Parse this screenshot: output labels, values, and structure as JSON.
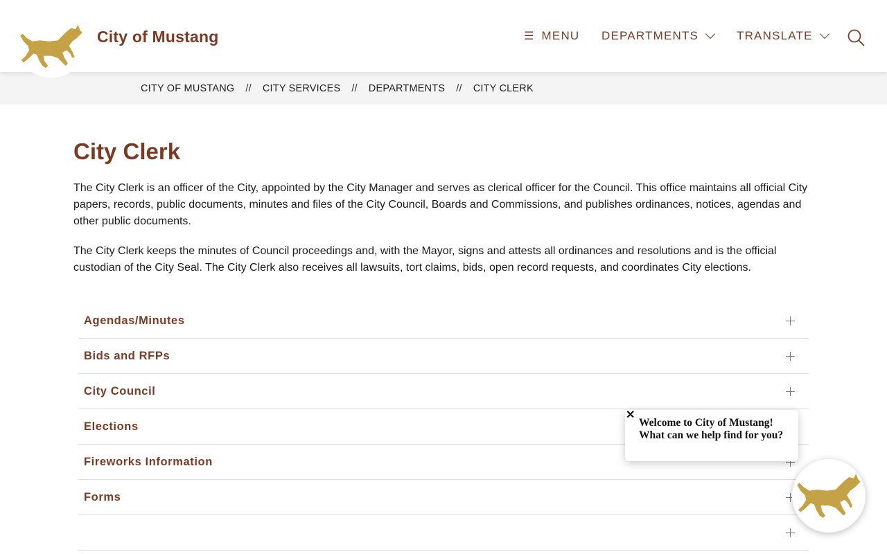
{
  "header": {
    "site_title": "City of Mustang",
    "logo_icon": "mustang-horse-logo",
    "nav": {
      "menu_label": "MENU",
      "menu_icon": "hamburger-icon",
      "departments_label": "DEPARTMENTS",
      "translate_label": "TRANSLATE",
      "search_icon": "search-icon"
    }
  },
  "breadcrumb": {
    "separator": "//",
    "items": [
      "CITY OF MUSTANG",
      "CITY SERVICES",
      "DEPARTMENTS",
      "CITY CLERK"
    ]
  },
  "main": {
    "title": "City Clerk",
    "paragraphs": [
      "The City Clerk is an officer of the City, appointed by the City Manager and serves as clerical officer for the Council.  This office maintains all official City papers, records, public documents, minutes and files of the City Council, Boards and Commissions, and publishes ordinances, notices, agendas and other public documents.",
      "The City Clerk keeps the minutes of Council proceedings and, with the Mayor, signs and attests all ordinances and resolutions and is the official custodian of the City Seal.  The City Clerk also receives all lawsuits, tort claims, bids, open record requests, and coordinates City elections."
    ],
    "accordion": [
      {
        "label": "Agendas/Minutes"
      },
      {
        "label": "Bids and RFPs"
      },
      {
        "label": "City Council"
      },
      {
        "label": "Elections"
      },
      {
        "label": "Fireworks Information"
      },
      {
        "label": "Forms"
      },
      {
        "label": ""
      }
    ]
  },
  "chat": {
    "close_glyph": "✕",
    "message": "Welcome to City of Mustang! What can we help find for you?"
  },
  "colors": {
    "brand_brown": "#7a3b24",
    "horse_gold": "#c4a245",
    "breadcrumb_bg": "#f4f4f4"
  }
}
